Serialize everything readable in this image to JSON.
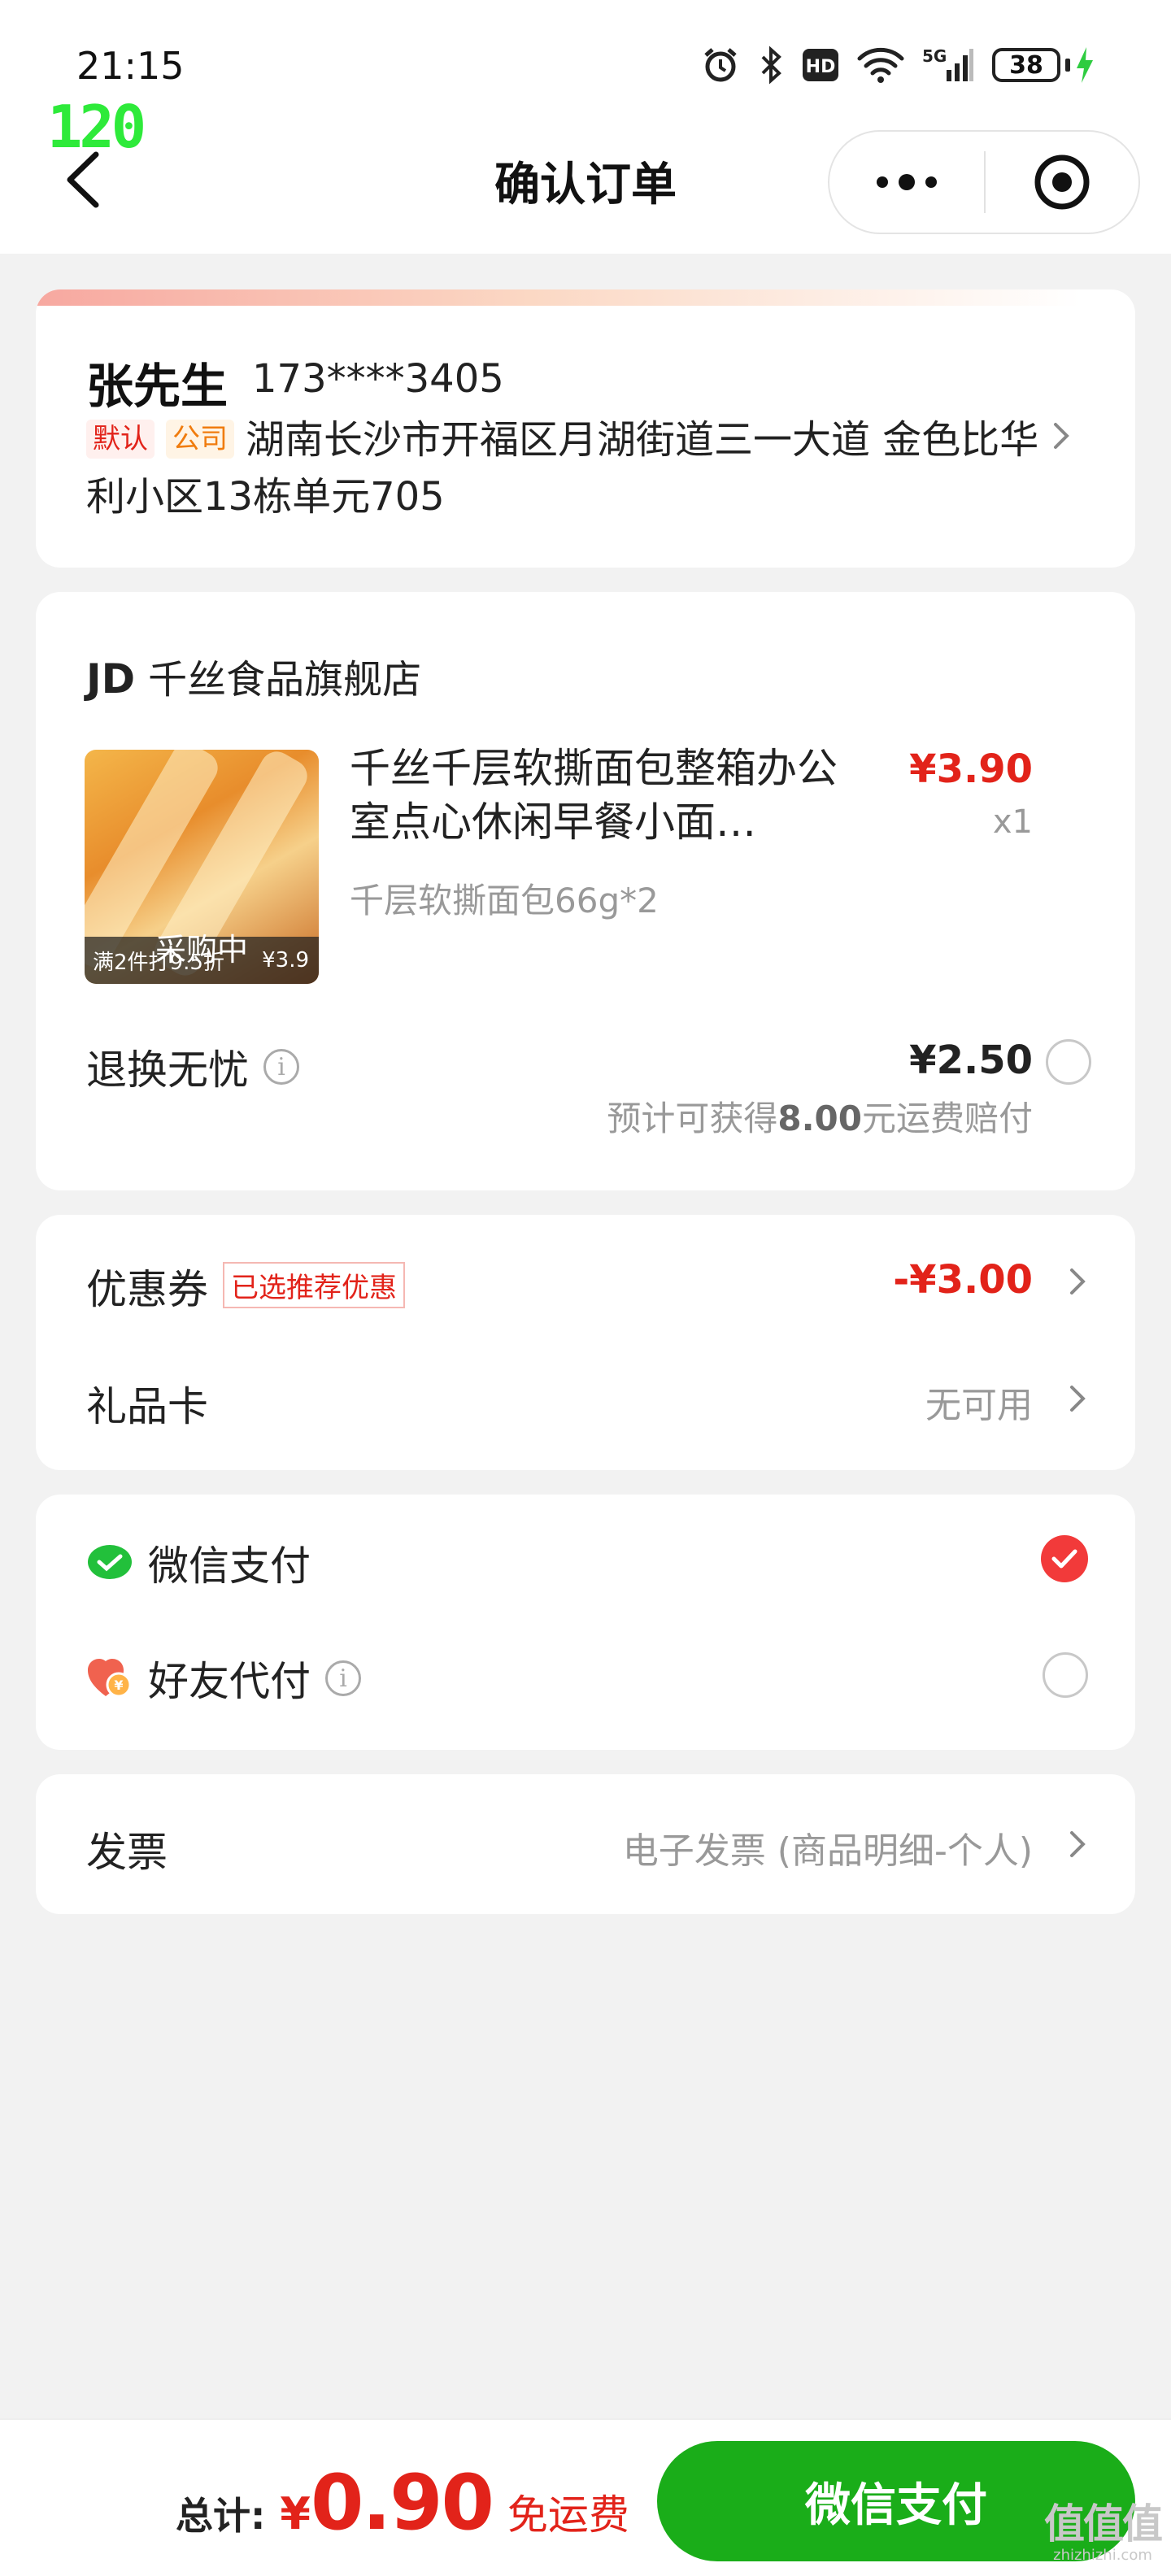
{
  "status_bar": {
    "time": "21:15",
    "fps": "120",
    "network": "5G",
    "battery": "38"
  },
  "nav": {
    "title": "确认订单"
  },
  "address": {
    "name": "张先生",
    "phone": "173****3405",
    "tag_default": "默认",
    "tag_company": "公司",
    "address": "湖南长沙市开福区月湖街道三一大道 金色比华利小区13栋单元705"
  },
  "store": {
    "brand": "JD",
    "name": "千丝食品旗舰店",
    "product": {
      "title": "千丝千层软撕面包整箱办公室点心休闲早餐小面…",
      "price": "¥3.90",
      "qty": "x1",
      "spec": "千层软撕面包66g*2",
      "image_status": "采购中",
      "image_promo": "满2件打9.5折",
      "image_price": "¥3.9"
    },
    "service": {
      "label": "退换无忧",
      "price": "¥2.50",
      "note_prefix": "预计可获得",
      "note_amount": "8.00",
      "note_suffix": "元运费赔付"
    }
  },
  "coupons": {
    "coupon_label": "优惠券",
    "coupon_tag": "已选推荐优惠",
    "coupon_value": "-¥3.00",
    "gift_label": "礼品卡",
    "gift_value": "无可用"
  },
  "payment": {
    "wechat_label": "微信支付",
    "friend_label": "好友代付",
    "selected": "wechat"
  },
  "invoice": {
    "label": "发票",
    "value": "电子发票 (商品明细-个人)"
  },
  "footer": {
    "total_label": "总计:",
    "currency": "¥",
    "amount": "0.90",
    "shipping": "免运费",
    "pay_button": "微信支付",
    "watermark": "值值值",
    "watermark_url": "zhizhizhi.com"
  },
  "colors": {
    "accent_red": "#e2231a",
    "wechat_green": "#1aad19",
    "background": "#f2f2f2"
  }
}
